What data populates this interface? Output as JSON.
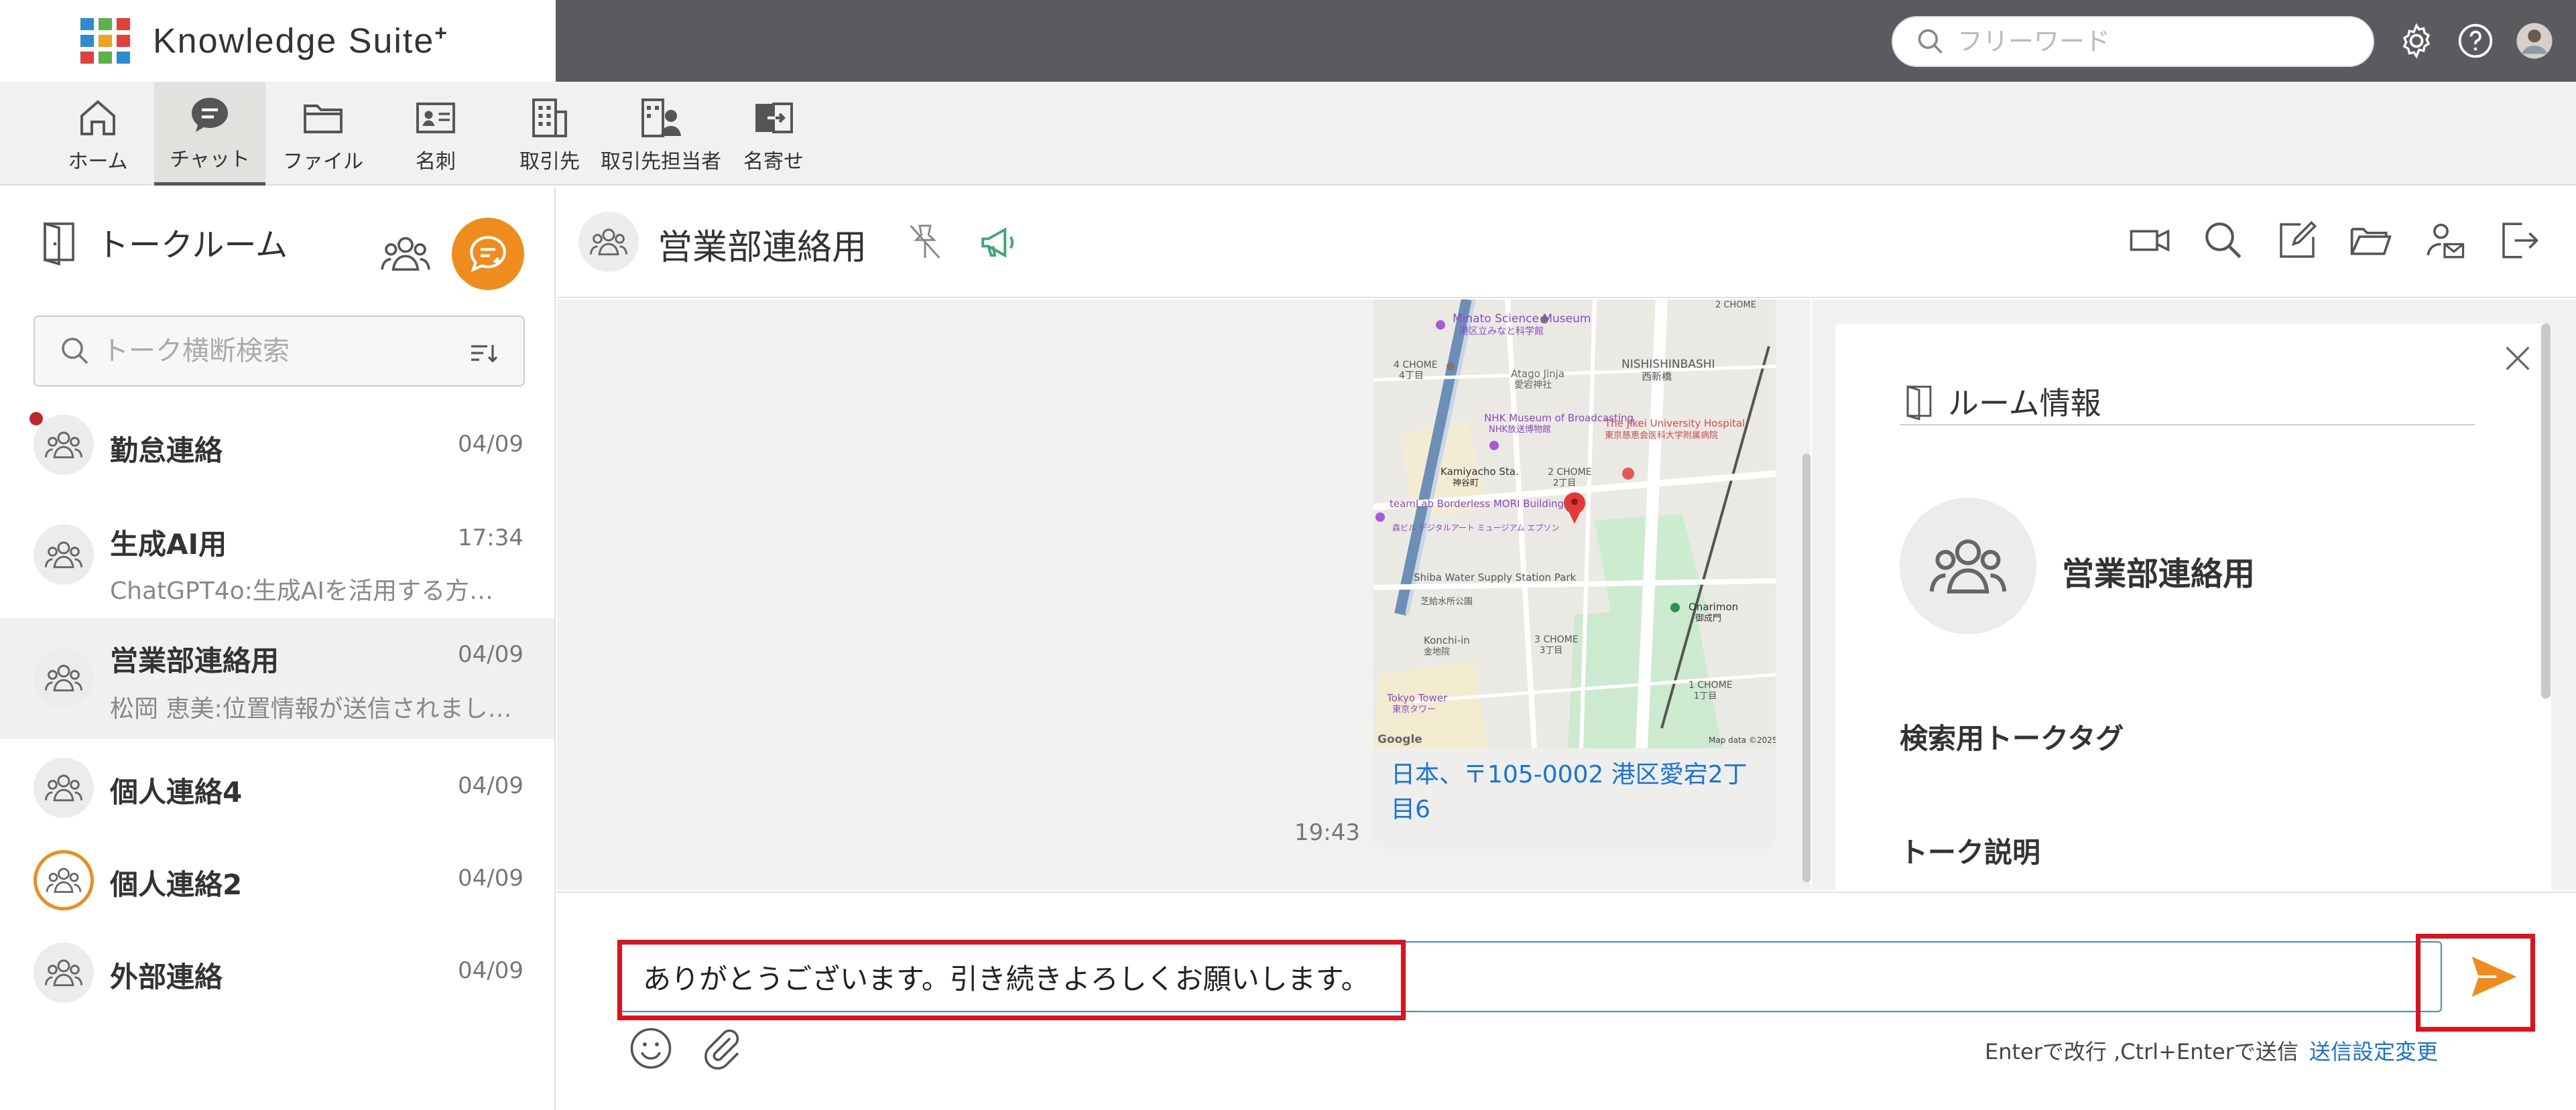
{
  "app": {
    "brand": "Knowledge Suite",
    "brand_mark": "+",
    "logo_colors": [
      "#2c8ccf",
      "#5bb14a",
      "#e23e3a",
      "#2c8ccf",
      "#f0a21f",
      "#e23e3a",
      "#e23e3a",
      "#5bb14a",
      "#2c8ccf"
    ],
    "accent_color": "#f08c1e",
    "link_color": "#1a73d9",
    "highlight_color": "#e0111a"
  },
  "topbar": {
    "search_placeholder": "フリーワード",
    "icons": [
      "gear-icon",
      "help-icon",
      "user-avatar"
    ]
  },
  "nav": {
    "items": [
      {
        "label": "ホーム",
        "icon": "home-icon"
      },
      {
        "label": "チャット",
        "icon": "chat-icon",
        "active": true
      },
      {
        "label": "ファイル",
        "icon": "folder-icon"
      },
      {
        "label": "名刺",
        "icon": "business-card-icon"
      },
      {
        "label": "取引先",
        "icon": "building-icon"
      },
      {
        "label": "取引先担当者",
        "icon": "contact-person-icon"
      },
      {
        "label": "名寄せ",
        "icon": "merge-icon"
      }
    ]
  },
  "sidebar": {
    "title": "トークルーム",
    "search_placeholder": "トーク横断検索",
    "rooms": [
      {
        "name": "勤怠連絡",
        "date": "04/09",
        "preview": "",
        "unread": true
      },
      {
        "name": "生成AI用",
        "date": "17:34",
        "preview": "ChatGPT4o:生成AIを活用する方法…"
      },
      {
        "name": "営業部連絡用",
        "date": "04/09",
        "preview": "松岡 恵美:位置情報が送信されまし…",
        "selected": true
      },
      {
        "name": "個人連絡4",
        "date": "04/09",
        "preview": ""
      },
      {
        "name": "個人連絡2",
        "date": "04/09",
        "preview": "",
        "ring": true
      },
      {
        "name": "外部連絡",
        "date": "04/09",
        "preview": ""
      }
    ]
  },
  "chat": {
    "room_name": "営業部連絡用",
    "header_tools": [
      "video-call-icon",
      "search-icon",
      "edit-icon",
      "folder-open-icon",
      "member-mail-icon",
      "leave-icon"
    ],
    "message": {
      "time": "19:43",
      "location_text": "日本、〒105-0002 港区愛宕2丁目6",
      "map_labels": {
        "minato_museum": "Minato Science Museum",
        "minato_museum_jp": "港区立みなと科学館",
        "chome4": "4 CHOME",
        "chome4_jp": "4丁目",
        "atago": "Atago Jinja",
        "atago_jp": "愛宕神社",
        "nishishinbashi": "NISHISHINBASHI",
        "nishishinbashi_jp": "西新橋",
        "nhk": "NHK Museum of Broadcasting",
        "nhk_jp": "NHK放送博物館",
        "jikei": "The Jikei University Hospital",
        "jikei_jp": "東京慈恵会医科大学附属病院",
        "kamiyacho": "Kamiyacho Sta.",
        "kamiyacho_jp": "神谷町",
        "chome2": "2 CHOME",
        "chome2_jp": "2丁目",
        "teamlab": "teamLab Borderless MORI Building…",
        "teamlab_jp": "森ビル デジタルアート ミュージアム エプソン",
        "shiba": "Shiba Water Supply Station Park",
        "shiba_jp": "芝給水所公園",
        "konchi": "Konchi-in",
        "konchi_jp": "金地院",
        "onarimon": "Onarimon",
        "onarimon_jp": "御成門",
        "chome3": "3 CHOME",
        "chome3_jp": "3丁目",
        "chome1": "1 CHOME",
        "chome1_jp": "1丁目",
        "tokyo_tower": "Tokyo Tower",
        "tokyo_tower_jp": "東京タワー",
        "chome2b": "2 CHOME",
        "google": "Google",
        "mapdata": "Map data ©2025"
      }
    }
  },
  "room_info": {
    "title": "ルーム情報",
    "room_name": "営業部連絡用",
    "tag_label": "検索用トークタグ",
    "desc_label": "トーク説明"
  },
  "compose": {
    "value": "ありがとうございます。引き続きよろしくお願いします。",
    "hint": "Enterで改行 ,Ctrl+Enterで送信",
    "settings_link": "送信設定変更"
  }
}
